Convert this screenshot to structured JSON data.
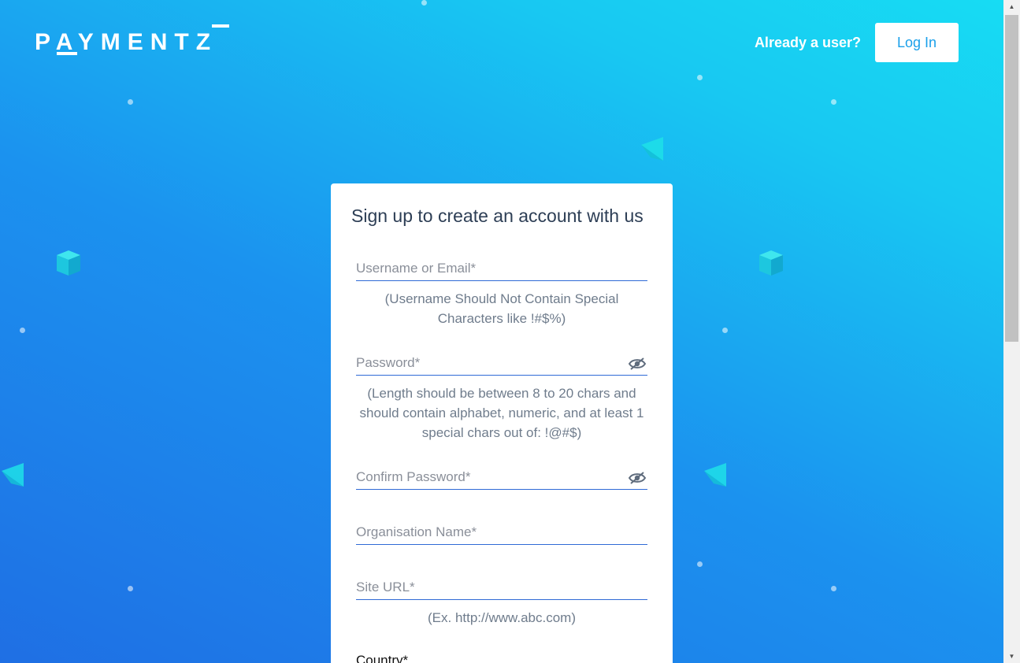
{
  "brand": {
    "logo_text": "PAYMENTZ"
  },
  "header": {
    "already_user": "Already a user?",
    "login_label": "Log In"
  },
  "form": {
    "title": "Sign up to create an account with us",
    "username": {
      "placeholder": "Username or Email*",
      "hint": "(Username Should Not Contain Special Characters like !#$%)"
    },
    "password": {
      "placeholder": "Password*",
      "hint": "(Length should be between 8 to 20 chars and should contain alphabet, numeric, and at least 1 special chars out of: !@#$)"
    },
    "confirm_password": {
      "placeholder": "Confirm Password*"
    },
    "organisation": {
      "placeholder": "Organisation Name*"
    },
    "site_url": {
      "placeholder": "Site URL*",
      "hint": "(Ex. http://www.abc.com)"
    },
    "country_label": "Country*"
  },
  "icons": {
    "eye": "eye-slash-icon"
  },
  "colors": {
    "accent": "#1aa0ea",
    "field_line": "#2f6ad6",
    "title": "#2d3e55",
    "hint": "#6f7c8c"
  }
}
